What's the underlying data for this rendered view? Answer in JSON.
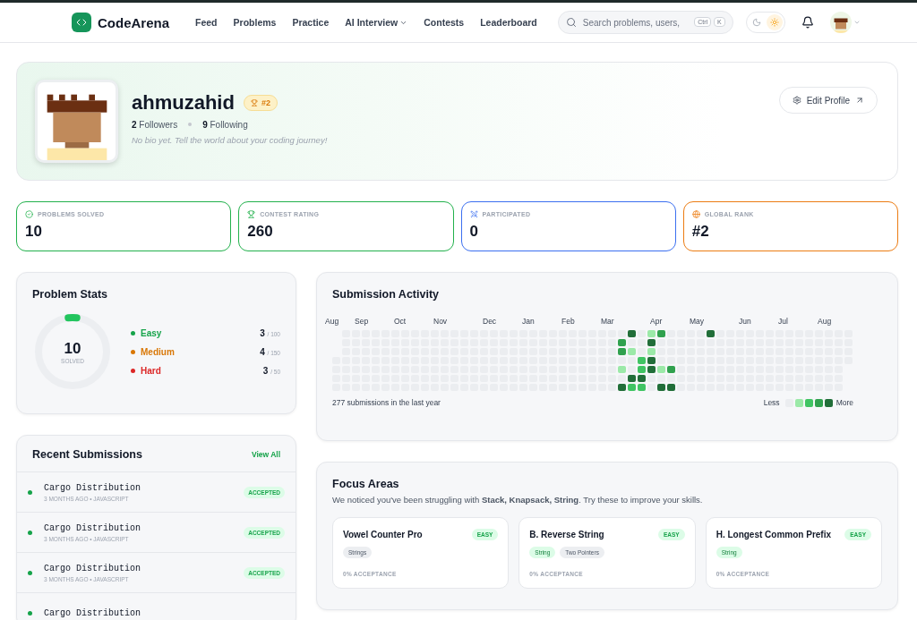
{
  "nav": {
    "brand": "CodeArena",
    "links": [
      {
        "label": "Feed",
        "has_menu": false
      },
      {
        "label": "Problems",
        "has_menu": false
      },
      {
        "label": "Practice",
        "has_menu": false
      },
      {
        "label": "AI Interview",
        "has_menu": true
      },
      {
        "label": "Contests",
        "has_menu": false
      },
      {
        "label": "Leaderboard",
        "has_menu": false
      }
    ],
    "search": {
      "placeholder": "Search problems, users,",
      "keys": [
        "Ctrl",
        "K"
      ]
    },
    "theme": [
      {
        "kind": "dark",
        "selected": false
      },
      {
        "kind": "light",
        "selected": true
      }
    ]
  },
  "profile": {
    "username": "ahmuzahid",
    "rank_badge": "#2",
    "followers": {
      "count": "2",
      "label": "Followers"
    },
    "following": {
      "count": "9",
      "label": "Following"
    },
    "bio": "No bio yet. Tell the world about your coding journey!",
    "edit_button": "Edit Profile"
  },
  "stats": [
    {
      "kind": "solved",
      "label": "PROBLEMS SOLVED",
      "value": "10",
      "color": "#22b14c"
    },
    {
      "kind": "rating",
      "label": "CONTEST RATING",
      "value": "260",
      "color": "#22b14c"
    },
    {
      "kind": "participated",
      "label": "PARTICIPATED",
      "value": "0",
      "color": "#3b6ff0"
    },
    {
      "kind": "rank",
      "label": "GLOBAL RANK",
      "value": "#2",
      "color": "#ec7c12"
    }
  ],
  "problem_stats": {
    "title": "Problem Stats",
    "total": "10",
    "total_label": "SOLVED",
    "level": 0.04,
    "difficulties": [
      {
        "label": "Easy",
        "solved": "3",
        "total": "/ 100",
        "color": "#16a34a"
      },
      {
        "label": "Medium",
        "solved": "4",
        "total": "/ 150",
        "color": "#d97706"
      },
      {
        "label": "Hard",
        "solved": "3",
        "total": "/ 50",
        "color": "#dc2626"
      }
    ]
  },
  "recent_submissions": {
    "title": "Recent Submissions",
    "view_all": "View All",
    "items": [
      {
        "problem": "Cargo Distribution",
        "meta": "3 MONTHS AGO • JAVASCRIPT",
        "status": "ACCEPTED"
      },
      {
        "problem": "Cargo Distribution",
        "meta": "3 MONTHS AGO • JAVASCRIPT",
        "status": "ACCEPTED"
      },
      {
        "problem": "Cargo Distribution",
        "meta": "3 MONTHS AGO • JAVASCRIPT",
        "status": "ACCEPTED"
      },
      {
        "problem": "Cargo Distribution"
      }
    ]
  },
  "activity": {
    "title": "Submission Activity",
    "summary": "277 submissions in the last year",
    "legend_less": "Less",
    "legend_more": "More",
    "weeks": [
      {
        "month": "Aug",
        "days": [
          {
            "color": "#ebedf0"
          },
          {
            "color": "#ebedf0"
          },
          {
            "color": "#ebedf0"
          },
          {
            "color": "#ebedf0"
          }
        ]
      },
      {
        "days": [
          {
            "color": "#ebedf0"
          },
          {
            "color": "#ebedf0"
          },
          {
            "color": "#ebedf0"
          },
          {
            "color": "#ebedf0"
          },
          {
            "color": "#ebedf0"
          },
          {
            "color": "#ebedf0"
          },
          {
            "color": "#ebedf0"
          }
        ]
      },
      {
        "days": [
          {
            "color": "#ebedf0"
          },
          {
            "color": "#ebedf0"
          },
          {
            "color": "#ebedf0"
          },
          {
            "color": "#ebedf0"
          },
          {
            "color": "#ebedf0"
          },
          {
            "color": "#ebedf0"
          },
          {
            "color": "#ebedf0"
          }
        ]
      },
      {
        "month": "Sep",
        "days": [
          {
            "color": "#ebedf0"
          },
          {
            "color": "#ebedf0"
          },
          {
            "color": "#ebedf0"
          },
          {
            "color": "#ebedf0"
          },
          {
            "color": "#ebedf0"
          },
          {
            "color": "#ebedf0"
          },
          {
            "color": "#ebedf0"
          }
        ]
      },
      {
        "days": [
          {
            "color": "#ebedf0"
          },
          {
            "color": "#ebedf0"
          },
          {
            "color": "#ebedf0"
          },
          {
            "color": "#ebedf0"
          },
          {
            "color": "#ebedf0"
          },
          {
            "color": "#ebedf0"
          },
          {
            "color": "#ebedf0"
          }
        ]
      },
      {
        "days": [
          {
            "color": "#ebedf0"
          },
          {
            "color": "#ebedf0"
          },
          {
            "color": "#ebedf0"
          },
          {
            "color": "#ebedf0"
          },
          {
            "color": "#ebedf0"
          },
          {
            "color": "#ebedf0"
          },
          {
            "color": "#ebedf0"
          }
        ]
      },
      {
        "days": [
          {
            "color": "#ebedf0"
          },
          {
            "color": "#ebedf0"
          },
          {
            "color": "#ebedf0"
          },
          {
            "color": "#ebedf0"
          },
          {
            "color": "#ebedf0"
          },
          {
            "color": "#ebedf0"
          },
          {
            "color": "#ebedf0"
          }
        ]
      },
      {
        "month": "Oct",
        "days": [
          {
            "color": "#ebedf0"
          },
          {
            "color": "#ebedf0"
          },
          {
            "color": "#ebedf0"
          },
          {
            "color": "#ebedf0"
          },
          {
            "color": "#ebedf0"
          },
          {
            "color": "#ebedf0"
          },
          {
            "color": "#ebedf0"
          }
        ]
      },
      {
        "days": [
          {
            "color": "#ebedf0"
          },
          {
            "color": "#ebedf0"
          },
          {
            "color": "#ebedf0"
          },
          {
            "color": "#ebedf0"
          },
          {
            "color": "#ebedf0"
          },
          {
            "color": "#ebedf0"
          },
          {
            "color": "#ebedf0"
          }
        ]
      },
      {
        "days": [
          {
            "color": "#ebedf0"
          },
          {
            "color": "#ebedf0"
          },
          {
            "color": "#ebedf0"
          },
          {
            "color": "#ebedf0"
          },
          {
            "color": "#ebedf0"
          },
          {
            "color": "#ebedf0"
          },
          {
            "color": "#ebedf0"
          }
        ]
      },
      {
        "days": [
          {
            "color": "#ebedf0"
          },
          {
            "color": "#ebedf0"
          },
          {
            "color": "#ebedf0"
          },
          {
            "color": "#ebedf0"
          },
          {
            "color": "#ebedf0"
          },
          {
            "color": "#ebedf0"
          },
          {
            "color": "#ebedf0"
          }
        ]
      },
      {
        "month": "Nov",
        "days": [
          {
            "color": "#ebedf0"
          },
          {
            "color": "#ebedf0"
          },
          {
            "color": "#ebedf0"
          },
          {
            "color": "#ebedf0"
          },
          {
            "color": "#ebedf0"
          },
          {
            "color": "#ebedf0"
          },
          {
            "color": "#ebedf0"
          }
        ]
      },
      {
        "days": [
          {
            "color": "#ebedf0"
          },
          {
            "color": "#ebedf0"
          },
          {
            "color": "#ebedf0"
          },
          {
            "color": "#ebedf0"
          },
          {
            "color": "#ebedf0"
          },
          {
            "color": "#ebedf0"
          },
          {
            "color": "#ebedf0"
          }
        ]
      },
      {
        "days": [
          {
            "color": "#ebedf0"
          },
          {
            "color": "#ebedf0"
          },
          {
            "color": "#ebedf0"
          },
          {
            "color": "#ebedf0"
          },
          {
            "color": "#ebedf0"
          },
          {
            "color": "#ebedf0"
          },
          {
            "color": "#ebedf0"
          }
        ]
      },
      {
        "days": [
          {
            "color": "#ebedf0"
          },
          {
            "color": "#ebedf0"
          },
          {
            "color": "#ebedf0"
          },
          {
            "color": "#ebedf0"
          },
          {
            "color": "#ebedf0"
          },
          {
            "color": "#ebedf0"
          },
          {
            "color": "#ebedf0"
          }
        ]
      },
      {
        "days": [
          {
            "color": "#ebedf0"
          },
          {
            "color": "#ebedf0"
          },
          {
            "color": "#ebedf0"
          },
          {
            "color": "#ebedf0"
          },
          {
            "color": "#ebedf0"
          },
          {
            "color": "#ebedf0"
          },
          {
            "color": "#ebedf0"
          }
        ]
      },
      {
        "month": "Dec",
        "days": [
          {
            "color": "#ebedf0"
          },
          {
            "color": "#ebedf0"
          },
          {
            "color": "#ebedf0"
          },
          {
            "color": "#ebedf0"
          },
          {
            "color": "#ebedf0"
          },
          {
            "color": "#ebedf0"
          },
          {
            "color": "#ebedf0"
          }
        ]
      },
      {
        "days": [
          {
            "color": "#ebedf0"
          },
          {
            "color": "#ebedf0"
          },
          {
            "color": "#ebedf0"
          },
          {
            "color": "#ebedf0"
          },
          {
            "color": "#ebedf0"
          },
          {
            "color": "#ebedf0"
          },
          {
            "color": "#ebedf0"
          }
        ]
      },
      {
        "days": [
          {
            "color": "#ebedf0"
          },
          {
            "color": "#ebedf0"
          },
          {
            "color": "#ebedf0"
          },
          {
            "color": "#ebedf0"
          },
          {
            "color": "#ebedf0"
          },
          {
            "color": "#ebedf0"
          },
          {
            "color": "#ebedf0"
          }
        ]
      },
      {
        "days": [
          {
            "color": "#ebedf0"
          },
          {
            "color": "#ebedf0"
          },
          {
            "color": "#ebedf0"
          },
          {
            "color": "#ebedf0"
          },
          {
            "color": "#ebedf0"
          },
          {
            "color": "#ebedf0"
          },
          {
            "color": "#ebedf0"
          }
        ]
      },
      {
        "month": "Jan",
        "days": [
          {
            "color": "#ebedf0"
          },
          {
            "color": "#ebedf0"
          },
          {
            "color": "#ebedf0"
          },
          {
            "color": "#ebedf0"
          },
          {
            "color": "#ebedf0"
          },
          {
            "color": "#ebedf0"
          },
          {
            "color": "#ebedf0"
          }
        ]
      },
      {
        "days": [
          {
            "color": "#ebedf0"
          },
          {
            "color": "#ebedf0"
          },
          {
            "color": "#ebedf0"
          },
          {
            "color": "#ebedf0"
          },
          {
            "color": "#ebedf0"
          },
          {
            "color": "#ebedf0"
          },
          {
            "color": "#ebedf0"
          }
        ]
      },
      {
        "days": [
          {
            "color": "#ebedf0"
          },
          {
            "color": "#ebedf0"
          },
          {
            "color": "#ebedf0"
          },
          {
            "color": "#ebedf0"
          },
          {
            "color": "#ebedf0"
          },
          {
            "color": "#ebedf0"
          },
          {
            "color": "#ebedf0"
          }
        ]
      },
      {
        "days": [
          {
            "color": "#ebedf0"
          },
          {
            "color": "#ebedf0"
          },
          {
            "color": "#ebedf0"
          },
          {
            "color": "#ebedf0"
          },
          {
            "color": "#ebedf0"
          },
          {
            "color": "#ebedf0"
          },
          {
            "color": "#ebedf0"
          }
        ]
      },
      {
        "month": "Feb",
        "days": [
          {
            "color": "#ebedf0"
          },
          {
            "color": "#ebedf0"
          },
          {
            "color": "#ebedf0"
          },
          {
            "color": "#ebedf0"
          },
          {
            "color": "#ebedf0"
          },
          {
            "color": "#ebedf0"
          },
          {
            "color": "#ebedf0"
          }
        ]
      },
      {
        "days": [
          {
            "color": "#ebedf0"
          },
          {
            "color": "#ebedf0"
          },
          {
            "color": "#ebedf0"
          },
          {
            "color": "#ebedf0"
          },
          {
            "color": "#ebedf0"
          },
          {
            "color": "#ebedf0"
          },
          {
            "color": "#ebedf0"
          }
        ]
      },
      {
        "days": [
          {
            "color": "#ebedf0"
          },
          {
            "color": "#ebedf0"
          },
          {
            "color": "#ebedf0"
          },
          {
            "color": "#ebedf0"
          },
          {
            "color": "#ebedf0"
          },
          {
            "color": "#ebedf0"
          },
          {
            "color": "#ebedf0"
          }
        ]
      },
      {
        "days": [
          {
            "color": "#ebedf0"
          },
          {
            "color": "#ebedf0"
          },
          {
            "color": "#ebedf0"
          },
          {
            "color": "#ebedf0"
          },
          {
            "color": "#ebedf0"
          },
          {
            "color": "#ebedf0"
          },
          {
            "color": "#ebedf0"
          }
        ]
      },
      {
        "month": "Mar",
        "days": [
          {
            "color": "#ebedf0"
          },
          {
            "color": "#ebedf0"
          },
          {
            "color": "#ebedf0"
          },
          {
            "color": "#ebedf0"
          },
          {
            "color": "#ebedf0"
          },
          {
            "color": "#ebedf0"
          },
          {
            "color": "#ebedf0"
          }
        ]
      },
      {
        "days": [
          {
            "color": "#ebedf0"
          },
          {
            "color": "#30a14e"
          },
          {
            "color": "#30a14e"
          },
          {
            "color": "#ebedf0"
          },
          {
            "color": "#9be9a8"
          },
          {
            "color": "#ebedf0"
          },
          {
            "color": "#216e39"
          }
        ]
      },
      {
        "days": [
          {
            "color": "#216e39"
          },
          {
            "color": "#ebedf0"
          },
          {
            "color": "#9be9a8"
          },
          {
            "color": "#ebedf0"
          },
          {
            "color": "#ebedf0"
          },
          {
            "color": "#216e39"
          },
          {
            "color": "#40c463"
          }
        ]
      },
      {
        "days": [
          {
            "color": "#ebedf0"
          },
          {
            "color": "#ebedf0"
          },
          {
            "color": "#ebedf0"
          },
          {
            "color": "#40c463"
          },
          {
            "color": "#40c463"
          },
          {
            "color": "#216e39"
          },
          {
            "color": "#40c463"
          }
        ]
      },
      {
        "days": [
          {
            "color": "#9be9a8"
          },
          {
            "color": "#216e39"
          },
          {
            "color": "#9be9a8"
          },
          {
            "color": "#216e39"
          },
          {
            "color": "#216e39"
          },
          {
            "color": "#ebedf0"
          },
          {
            "color": "#ebedf0"
          }
        ]
      },
      {
        "month": "Apr",
        "days": [
          {
            "color": "#30a14e"
          },
          {
            "color": "#ebedf0"
          },
          {
            "color": "#ebedf0"
          },
          {
            "color": "#ebedf0"
          },
          {
            "color": "#9be9a8"
          },
          {
            "color": "#ebedf0"
          },
          {
            "color": "#216e39"
          }
        ]
      },
      {
        "days": [
          {
            "color": "#ebedf0"
          },
          {
            "color": "#ebedf0"
          },
          {
            "color": "#ebedf0"
          },
          {
            "color": "#ebedf0"
          },
          {
            "color": "#30a14e"
          },
          {
            "color": "#ebedf0"
          },
          {
            "color": "#216e39"
          }
        ]
      },
      {
        "days": [
          {
            "color": "#ebedf0"
          },
          {
            "color": "#ebedf0"
          },
          {
            "color": "#ebedf0"
          },
          {
            "color": "#ebedf0"
          },
          {
            "color": "#ebedf0"
          },
          {
            "color": "#ebedf0"
          },
          {
            "color": "#ebedf0"
          }
        ]
      },
      {
        "days": [
          {
            "color": "#ebedf0"
          },
          {
            "color": "#ebedf0"
          },
          {
            "color": "#ebedf0"
          },
          {
            "color": "#ebedf0"
          },
          {
            "color": "#ebedf0"
          },
          {
            "color": "#ebedf0"
          },
          {
            "color": "#ebedf0"
          }
        ]
      },
      {
        "month": "May",
        "days": [
          {
            "color": "#ebedf0"
          },
          {
            "color": "#ebedf0"
          },
          {
            "color": "#ebedf0"
          },
          {
            "color": "#ebedf0"
          },
          {
            "color": "#ebedf0"
          },
          {
            "color": "#ebedf0"
          },
          {
            "color": "#ebedf0"
          }
        ]
      },
      {
        "days": [
          {
            "color": "#216e39"
          },
          {
            "color": "#ebedf0"
          },
          {
            "color": "#ebedf0"
          },
          {
            "color": "#ebedf0"
          },
          {
            "color": "#ebedf0"
          },
          {
            "color": "#ebedf0"
          },
          {
            "color": "#ebedf0"
          }
        ]
      },
      {
        "days": [
          {
            "color": "#ebedf0"
          },
          {
            "color": "#ebedf0"
          },
          {
            "color": "#ebedf0"
          },
          {
            "color": "#ebedf0"
          },
          {
            "color": "#ebedf0"
          },
          {
            "color": "#ebedf0"
          },
          {
            "color": "#ebedf0"
          }
        ]
      },
      {
        "days": [
          {
            "color": "#ebedf0"
          },
          {
            "color": "#ebedf0"
          },
          {
            "color": "#ebedf0"
          },
          {
            "color": "#ebedf0"
          },
          {
            "color": "#ebedf0"
          },
          {
            "color": "#ebedf0"
          },
          {
            "color": "#ebedf0"
          }
        ]
      },
      {
        "days": [
          {
            "color": "#ebedf0"
          },
          {
            "color": "#ebedf0"
          },
          {
            "color": "#ebedf0"
          },
          {
            "color": "#ebedf0"
          },
          {
            "color": "#ebedf0"
          },
          {
            "color": "#ebedf0"
          },
          {
            "color": "#ebedf0"
          }
        ]
      },
      {
        "month": "Jun",
        "days": [
          {
            "color": "#ebedf0"
          },
          {
            "color": "#ebedf0"
          },
          {
            "color": "#ebedf0"
          },
          {
            "color": "#ebedf0"
          },
          {
            "color": "#ebedf0"
          },
          {
            "color": "#ebedf0"
          },
          {
            "color": "#ebedf0"
          }
        ]
      },
      {
        "days": [
          {
            "color": "#ebedf0"
          },
          {
            "color": "#ebedf0"
          },
          {
            "color": "#ebedf0"
          },
          {
            "color": "#ebedf0"
          },
          {
            "color": "#ebedf0"
          },
          {
            "color": "#ebedf0"
          },
          {
            "color": "#ebedf0"
          }
        ]
      },
      {
        "days": [
          {
            "color": "#ebedf0"
          },
          {
            "color": "#ebedf0"
          },
          {
            "color": "#ebedf0"
          },
          {
            "color": "#ebedf0"
          },
          {
            "color": "#ebedf0"
          },
          {
            "color": "#ebedf0"
          },
          {
            "color": "#ebedf0"
          }
        ]
      },
      {
        "days": [
          {
            "color": "#ebedf0"
          },
          {
            "color": "#ebedf0"
          },
          {
            "color": "#ebedf0"
          },
          {
            "color": "#ebedf0"
          },
          {
            "color": "#ebedf0"
          },
          {
            "color": "#ebedf0"
          },
          {
            "color": "#ebedf0"
          }
        ]
      },
      {
        "month": "Jul",
        "days": [
          {
            "color": "#ebedf0"
          },
          {
            "color": "#ebedf0"
          },
          {
            "color": "#ebedf0"
          },
          {
            "color": "#ebedf0"
          },
          {
            "color": "#ebedf0"
          },
          {
            "color": "#ebedf0"
          },
          {
            "color": "#ebedf0"
          }
        ]
      },
      {
        "days": [
          {
            "color": "#ebedf0"
          },
          {
            "color": "#ebedf0"
          },
          {
            "color": "#ebedf0"
          },
          {
            "color": "#ebedf0"
          },
          {
            "color": "#ebedf0"
          },
          {
            "color": "#ebedf0"
          },
          {
            "color": "#ebedf0"
          }
        ]
      },
      {
        "days": [
          {
            "color": "#ebedf0"
          },
          {
            "color": "#ebedf0"
          },
          {
            "color": "#ebedf0"
          },
          {
            "color": "#ebedf0"
          },
          {
            "color": "#ebedf0"
          },
          {
            "color": "#ebedf0"
          },
          {
            "color": "#ebedf0"
          }
        ]
      },
      {
        "days": [
          {
            "color": "#ebedf0"
          },
          {
            "color": "#ebedf0"
          },
          {
            "color": "#ebedf0"
          },
          {
            "color": "#ebedf0"
          },
          {
            "color": "#ebedf0"
          },
          {
            "color": "#ebedf0"
          },
          {
            "color": "#ebedf0"
          }
        ]
      },
      {
        "month": "Aug",
        "days": [
          {
            "color": "#ebedf0"
          },
          {
            "color": "#ebedf0"
          },
          {
            "color": "#ebedf0"
          },
          {
            "color": "#ebedf0"
          },
          {
            "color": "#ebedf0"
          },
          {
            "color": "#ebedf0"
          },
          {
            "color": "#ebedf0"
          }
        ]
      },
      {
        "days": [
          {
            "color": "#ebedf0"
          },
          {
            "color": "#ebedf0"
          },
          {
            "color": "#ebedf0"
          },
          {
            "color": "#ebedf0"
          },
          {
            "color": "#ebedf0"
          },
          {
            "color": "#ebedf0"
          },
          {
            "color": "#ebedf0"
          }
        ]
      },
      {
        "days": [
          {
            "color": "#ebedf0"
          },
          {
            "color": "#ebedf0"
          },
          {
            "color": "#ebedf0"
          },
          {
            "color": "#ebedf0"
          }
        ]
      }
    ]
  },
  "focus": {
    "title": "Focus Areas",
    "description": "We noticed you've been struggling with **Stack, Knapsack, String**. Try these to improve your skills.",
    "problems": [
      {
        "title": "Vowel Counter Pro",
        "difficulty": "EASY",
        "tags": [
          {
            "label": "Strings",
            "kind": "plain"
          }
        ],
        "acceptance": "0% ACCEPTANCE"
      },
      {
        "title": "B. Reverse String",
        "difficulty": "EASY",
        "tags": [
          {
            "label": "String",
            "kind": "focus"
          },
          {
            "label": "Two Pointers",
            "kind": "plain"
          }
        ],
        "acceptance": "0% ACCEPTANCE"
      },
      {
        "title": "H. Longest Common Prefix",
        "difficulty": "EASY",
        "tags": [
          {
            "label": "String",
            "kind": "focus"
          }
        ],
        "acceptance": "0% ACCEPTANCE"
      }
    ]
  }
}
